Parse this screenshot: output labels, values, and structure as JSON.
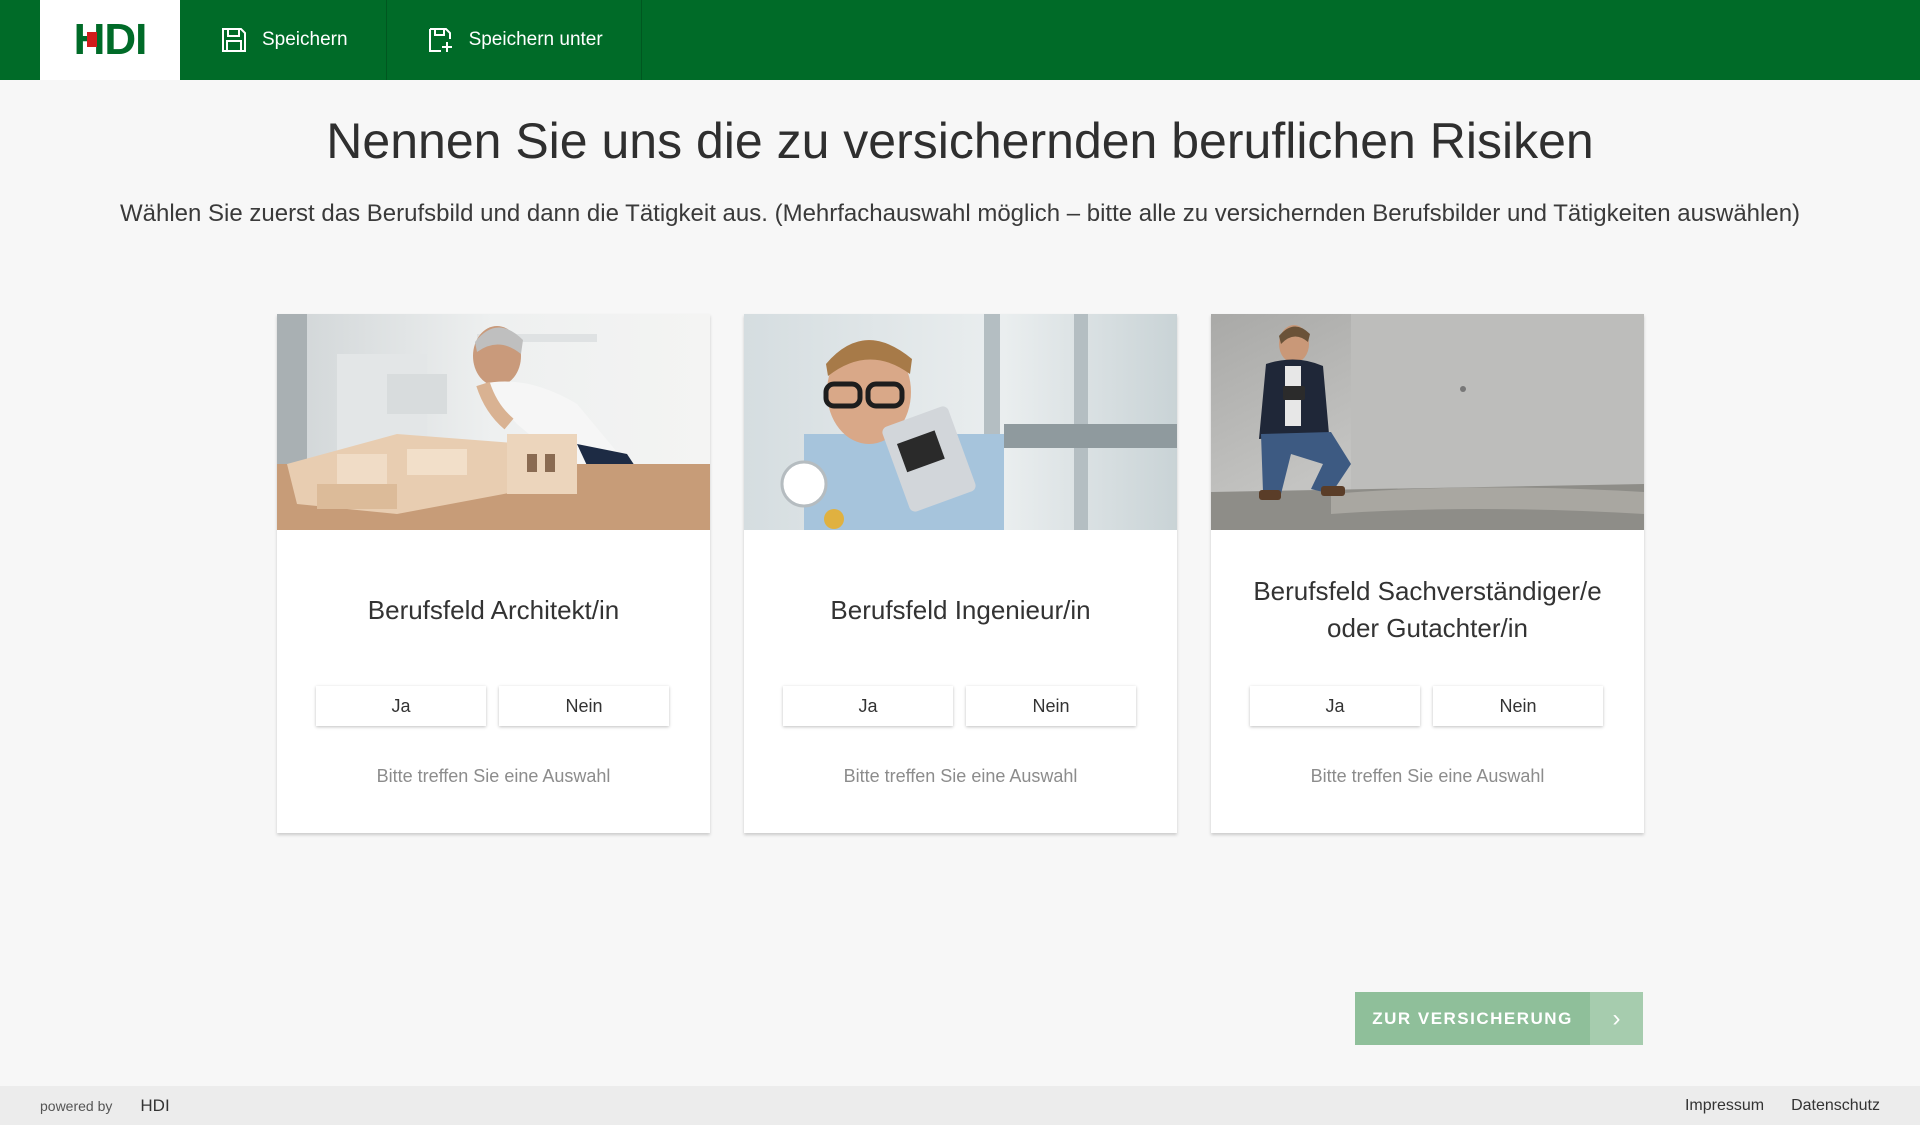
{
  "header": {
    "logo_text": "HDI",
    "save_label": "Speichern",
    "save_as_label": "Speichern unter"
  },
  "main": {
    "title": "Nennen Sie uns die zu versichernden beruflichen Risiken",
    "subtitle": "Wählen Sie zuerst das Berufsbild und dann die Tätigkeit aus. (Mehrfachauswahl möglich – bitte alle zu versichernden Berufsbilder und Tätigkeiten auswählen)",
    "cards": [
      {
        "title": "Berufsfeld Architekt/in",
        "yes_label": "Ja",
        "no_label": "Nein",
        "hint": "Bitte treffen Sie eine Auswahl"
      },
      {
        "title": "Berufsfeld Ingenieur/in",
        "yes_label": "Ja",
        "no_label": "Nein",
        "hint": "Bitte treffen Sie eine Auswahl"
      },
      {
        "title": "Berufsfeld Sachverständiger/e oder Gutachter/in",
        "yes_label": "Ja",
        "no_label": "Nein",
        "hint": "Bitte treffen Sie eine Auswahl"
      }
    ],
    "cta_label": "ZUR VERSICHERUNG",
    "cta_arrow": "›"
  },
  "footer": {
    "powered_by": "powered by",
    "brand": "HDI",
    "impressum": "Impressum",
    "datenschutz": "Datenschutz"
  },
  "colors": {
    "brand_green": "#006b28",
    "logo_red": "#d21c1c",
    "cta_green": "#8fbf9a"
  }
}
